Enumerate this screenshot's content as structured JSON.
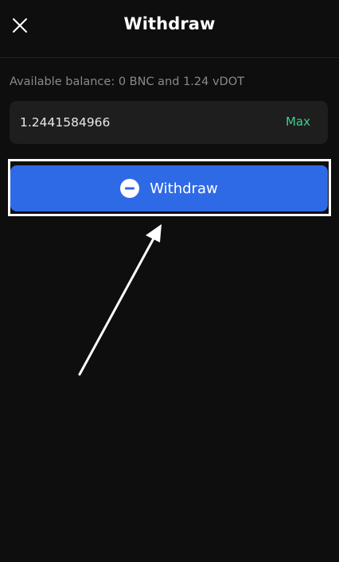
{
  "header": {
    "title": "Withdraw",
    "close_icon": "close-icon"
  },
  "balance": {
    "text": "Available balance: 0 BNC and 1.24 vDOT"
  },
  "amount": {
    "value": "1.2441584966",
    "max_label": "Max"
  },
  "action": {
    "withdraw_label": "Withdraw",
    "icon": "minus-circle-icon"
  },
  "colors": {
    "background": "#0e0e0e",
    "input_background": "#1e1e1e",
    "button_blue": "#2f6ae6",
    "max_green": "#3ecf8e",
    "balance_gray": "#8a8a8a"
  }
}
